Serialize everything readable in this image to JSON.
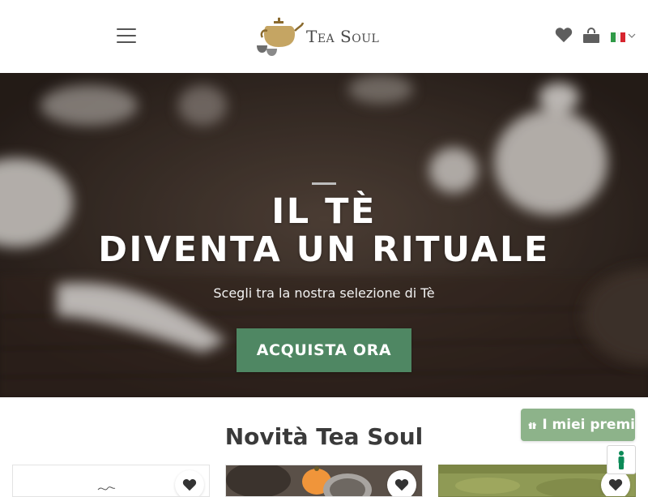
{
  "header": {
    "logo_text": "Tea Soul",
    "menu_icon": "hamburger-icon",
    "wishlist_icon": "heart-icon",
    "cart_icon": "shopping-bag-icon",
    "language_icon": "italy-flag-icon"
  },
  "hero": {
    "title_line1": "IL TÈ",
    "title_line2": "DIVENTA UN RITUALE",
    "subtitle": "Scegli tra la nostra selezione di Tè",
    "cta_label": "ACQUISTA ORA"
  },
  "section": {
    "title": "Novità Tea Soul"
  },
  "rewards": {
    "label": "I miei premi",
    "icon": "gift-icon"
  },
  "accessibility": {
    "icon": "accessibility-icon"
  },
  "products": [
    {
      "wishlist_icon": "heart-icon"
    },
    {
      "wishlist_icon": "heart-icon"
    },
    {
      "wishlist_icon": "heart-icon"
    }
  ],
  "colors": {
    "brand_green": "#4f8763",
    "rewards_green": "#8db38a",
    "logo_gold": "#b6954a",
    "text_dark": "#3a3a3a"
  }
}
